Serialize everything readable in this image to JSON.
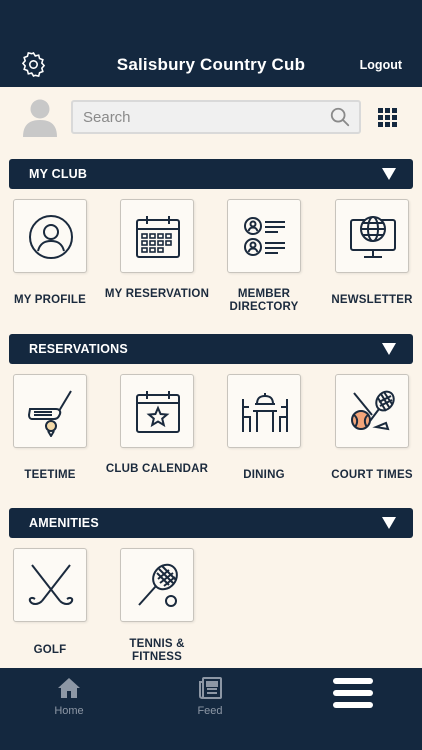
{
  "header": {
    "title": "Salisbury Country Cub",
    "logout_label": "Logout",
    "settings_icon": "gear-icon"
  },
  "search": {
    "placeholder": "Search"
  },
  "sections": [
    {
      "label": "MY CLUB",
      "items": [
        {
          "label": "MY PROFILE",
          "icon": "profile-icon"
        },
        {
          "label": "MY RESERVATION",
          "icon": "calendar-icon"
        },
        {
          "label": "MEMBER DIRECTORY",
          "icon": "directory-icon"
        },
        {
          "label": "NEWSLETTER",
          "icon": "globe-monitor-icon"
        }
      ]
    },
    {
      "label": "RESERVATIONS",
      "items": [
        {
          "label": "TEETIME",
          "icon": "golf-teetime-icon"
        },
        {
          "label": "CLUB CALENDAR",
          "icon": "calendar-star-icon"
        },
        {
          "label": "DINING",
          "icon": "dining-icon"
        },
        {
          "label": "COURT TIMES",
          "icon": "court-sports-icon"
        }
      ]
    },
    {
      "label": "AMENITIES",
      "items": [
        {
          "label": "GOLF",
          "icon": "golf-clubs-icon"
        },
        {
          "label": "TENNIS & FITNESS",
          "icon": "tennis-icon"
        }
      ]
    }
  ],
  "tabbar": {
    "home_label": "Home",
    "feed_label": "Feed",
    "menu_icon": "hamburger-menu-icon"
  },
  "colors": {
    "navy": "#14283f",
    "background": "#fbf4ea",
    "tab_label": "#8d97a5"
  }
}
